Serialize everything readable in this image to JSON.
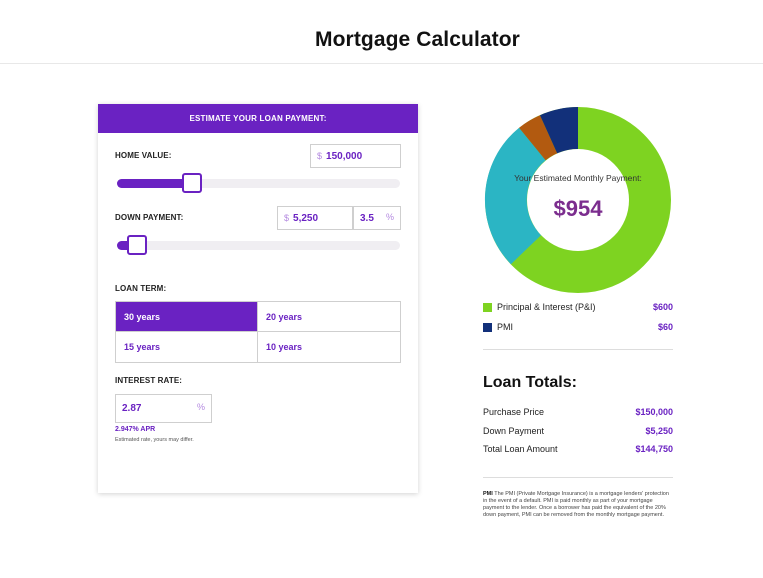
{
  "page": {
    "title": "Mortgage Calculator"
  },
  "card": {
    "header": "ESTIMATE YOUR LOAN PAYMENT:",
    "home_value": {
      "label": "HOME VALUE:",
      "prefix": "$",
      "value": "150,000",
      "slider_fraction": 0.23
    },
    "down_payment": {
      "label": "DOWN PAYMENT:",
      "prefix": "$",
      "value": "5,250",
      "percent": "3.5",
      "percent_suffix": "%",
      "slider_fraction": 0.035
    },
    "loan_term": {
      "label": "LOAN TERM:",
      "options": [
        "30 years",
        "20 years",
        "15 years",
        "10 years"
      ],
      "selected": "30 years"
    },
    "interest_rate": {
      "label": "INTEREST RATE:",
      "value": "2.87",
      "suffix": "%",
      "apr": "2.947% APR",
      "note": "Estimated rate, yours may differ."
    }
  },
  "summary": {
    "estimate_label": "Your Estimated Monthly Payment:",
    "estimate_value": "$954",
    "donut_colors": {
      "principal": "#7ed321",
      "taxes": "#2bb5c4",
      "insurance": "#b25a10",
      "pmi": "#12307a"
    },
    "legend": [
      {
        "name": "Principal & Interest (P&I)",
        "value": "$600",
        "color": "#7ed321"
      },
      {
        "name": "PMI",
        "value": "$60",
        "color": "#12307a"
      }
    ]
  },
  "totals": {
    "title": "Loan Totals:",
    "rows": [
      {
        "label": "Purchase Price",
        "value": "$150,000"
      },
      {
        "label": "Down Payment",
        "value": "$5,250"
      },
      {
        "label": "Total Loan Amount",
        "value": "$144,750"
      }
    ]
  },
  "pmi_note": {
    "term": "PMI",
    "text": "The PMI (Private Mortgage Insurance) is a mortgage lenders' protection in the event of a default. PMI is paid monthly as part of your mortgage payment to the lender. Once a borrower has paid the equivalent of the 20% down payment, PMI can be removed from the monthly mortgage payment."
  }
}
